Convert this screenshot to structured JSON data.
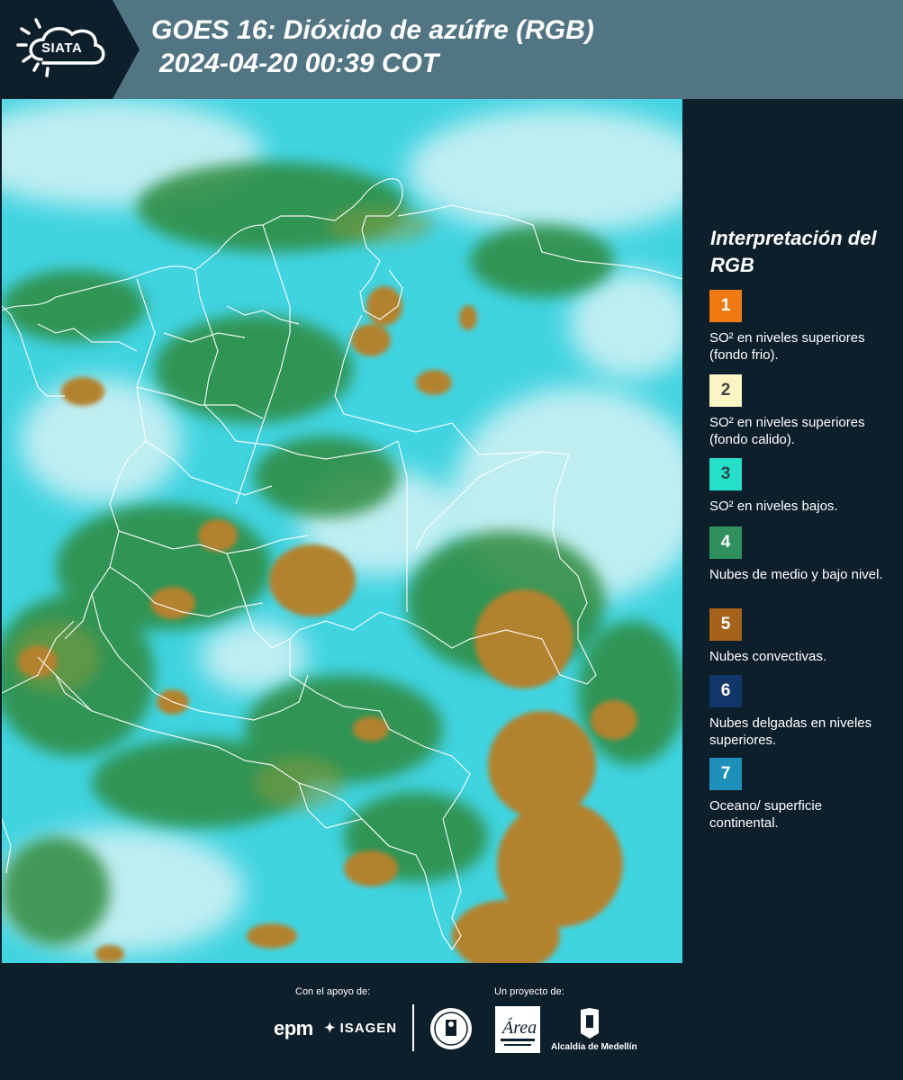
{
  "header": {
    "logo_text": "SIATA",
    "title_line1": "GOES 16: Dióxido de azúfre (RGB)",
    "title_line2": "2024-04-20 00:39 COT"
  },
  "map": {
    "description_colors": {
      "background": "#3fd6e3",
      "cloud_light": "#d8f4f6",
      "green": "#2f8d3c",
      "convective": "#b5822d"
    }
  },
  "legend": {
    "title": "Interpretación del RGB",
    "items": [
      {
        "number": "1",
        "color": "#f07a12",
        "text_color": "#ffffff",
        "label": "SO² en niveles superiores (fondo frio)."
      },
      {
        "number": "2",
        "color": "#fbf5c4",
        "text_color": "#444444",
        "label": "SO² en niveles superiores (fondo calido)."
      },
      {
        "number": "3",
        "color": "#24e0cb",
        "text_color": "#2a4a4a",
        "label": "SO² en niveles bajos."
      },
      {
        "number": "4",
        "color": "#2f8f5d",
        "text_color": "#ffffff",
        "label": "Nubes de medio y bajo nivel."
      },
      {
        "number": "5",
        "color": "#a4621a",
        "text_color": "#ffffff",
        "label": "Nubes convectivas."
      },
      {
        "number": "6",
        "color": "#12366a",
        "text_color": "#ffffff",
        "label": "Nubes delgadas en niveles superiores."
      },
      {
        "number": "7",
        "color": "#1d8fb8",
        "text_color": "#ffffff",
        "label": "Oceano/ superficie continental."
      }
    ]
  },
  "footer": {
    "support_label": "Con el apoyo de:",
    "project_label": "Un proyecto de:",
    "epm": "epm",
    "isagen": "ISAGEN",
    "alcaldia": "Alcaldía de Medellín"
  }
}
